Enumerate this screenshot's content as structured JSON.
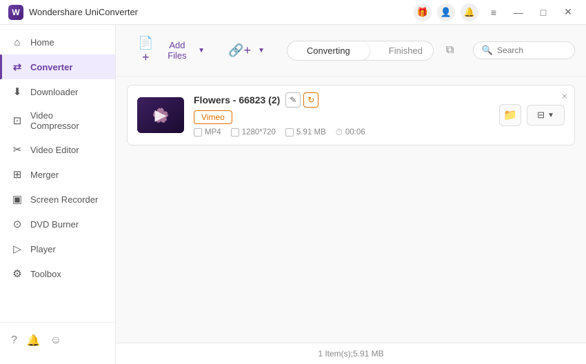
{
  "titleBar": {
    "appName": "Wondershare UniConverter",
    "icons": {
      "gift": "🎁",
      "user": "👤",
      "bell": "🔔"
    },
    "windowControls": {
      "minimize": "—",
      "maximize": "□",
      "close": "✕"
    }
  },
  "sidebar": {
    "items": [
      {
        "id": "home",
        "label": "Home",
        "icon": "⌂"
      },
      {
        "id": "converter",
        "label": "Converter",
        "icon": "↔",
        "active": true
      },
      {
        "id": "downloader",
        "label": "Downloader",
        "icon": "↓"
      },
      {
        "id": "video-compressor",
        "label": "Video Compressor",
        "icon": "⊡"
      },
      {
        "id": "video-editor",
        "label": "Video Editor",
        "icon": "✂"
      },
      {
        "id": "merger",
        "label": "Merger",
        "icon": "⊞"
      },
      {
        "id": "screen-recorder",
        "label": "Screen Recorder",
        "icon": "▣"
      },
      {
        "id": "dvd-burner",
        "label": "DVD Burner",
        "icon": "⊙"
      },
      {
        "id": "player",
        "label": "Player",
        "icon": "▷"
      },
      {
        "id": "toolbox",
        "label": "Toolbox",
        "icon": "⚙"
      }
    ],
    "bottomIcons": {
      "help": "?",
      "notification": "🔔",
      "feedback": "☺"
    }
  },
  "toolbar": {
    "addFileLabel": "Add Files",
    "addUrlLabel": "Add URL",
    "searchPlaceholder": "Search"
  },
  "tabs": {
    "converting": "Converting",
    "finished": "Finished",
    "activeTab": "converting"
  },
  "fileCard": {
    "title": "Flowers - 66823 (2)",
    "platform": "Vimeo",
    "format": "MP4",
    "resolution": "1280*720",
    "size": "5.91 MB",
    "duration": "00:06",
    "closeBtn": "×"
  },
  "statusBar": {
    "text": "1 Item(s);5.91 MB"
  }
}
